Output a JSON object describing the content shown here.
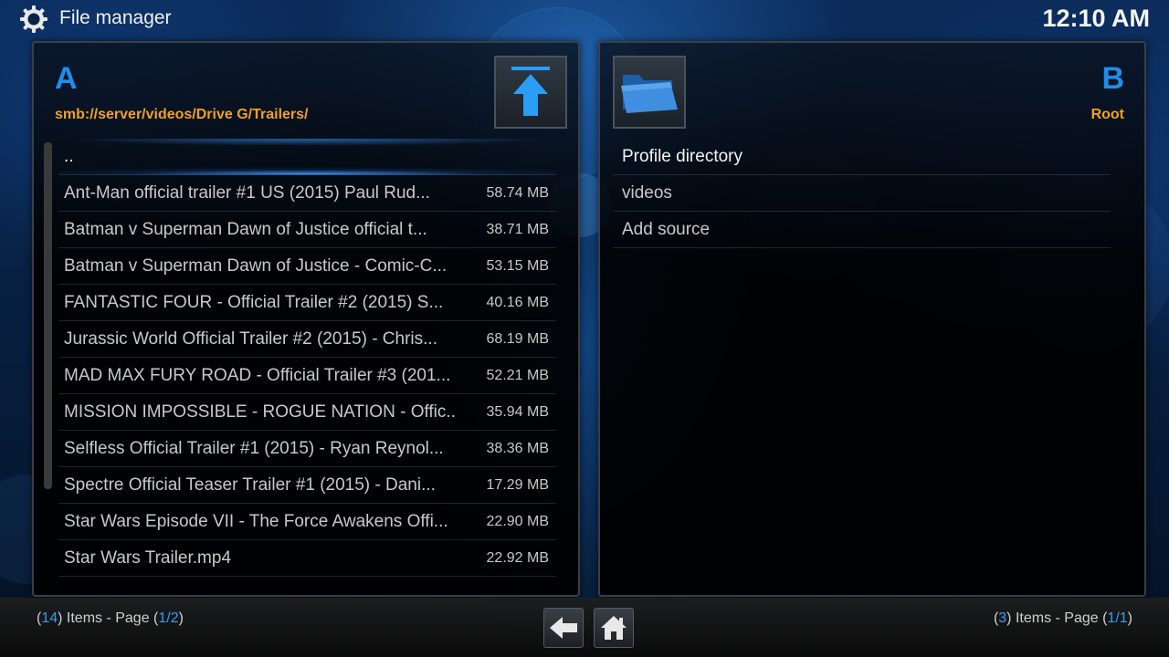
{
  "header": {
    "title": "File manager",
    "time": "12:10 AM"
  },
  "panel_a": {
    "letter": "A",
    "path": "smb://server/videos/Drive G/Trailers/",
    "tile_icon": "up-arrow-icon",
    "items": [
      {
        "name": "..",
        "size": ""
      },
      {
        "name": "Ant-Man  official trailer #1 US (2015) Paul Rud...",
        "size": "58.74 MB"
      },
      {
        "name": "Batman v Superman Dawn of Justice  official t...",
        "size": "38.71 MB"
      },
      {
        "name": "Batman v Superman Dawn of Justice - Comic-C...",
        "size": "53.15 MB"
      },
      {
        "name": "FANTASTIC FOUR - Official Trailer #2 (2015) S...",
        "size": "40.16 MB"
      },
      {
        "name": "Jurassic World Official Trailer #2 (2015) - Chris...",
        "size": "68.19 MB"
      },
      {
        "name": "MAD MAX FURY ROAD - Official Trailer #3 (201...",
        "size": "52.21 MB"
      },
      {
        "name": "MISSION IMPOSSIBLE - ROGUE NATION - Offic...",
        "size": "35.94 MB"
      },
      {
        "name": "Selfless Official Trailer #1 (2015) - Ryan Reynol...",
        "size": "38.36 MB"
      },
      {
        "name": "Spectre Official Teaser Trailer #1 (2015) - Dani...",
        "size": "17.29 MB"
      },
      {
        "name": "Star Wars Episode VII - The Force Awakens Offi...",
        "size": "22.90 MB"
      },
      {
        "name": "Star Wars Trailer.mp4",
        "size": "22.92 MB"
      }
    ]
  },
  "panel_b": {
    "letter": "B",
    "path": "Root",
    "tile_icon": "folder-icon",
    "items": [
      {
        "name": "Profile directory"
      },
      {
        "name": "videos"
      },
      {
        "name": "Add source"
      }
    ]
  },
  "footer": {
    "a_count": "14",
    "a_text_mid": ") Items - Page (",
    "a_page": "1/2",
    "b_count": "3",
    "b_text_mid": ") Items - Page (",
    "b_page": "1/1",
    "open_paren": "(",
    "close_paren": ")",
    "back_icon": "back-arrow-icon",
    "home_icon": "home-icon"
  },
  "colors": {
    "accent_blue": "#1e8ee8",
    "path_orange": "#f0a020",
    "count_blue": "#3a9cf0"
  }
}
